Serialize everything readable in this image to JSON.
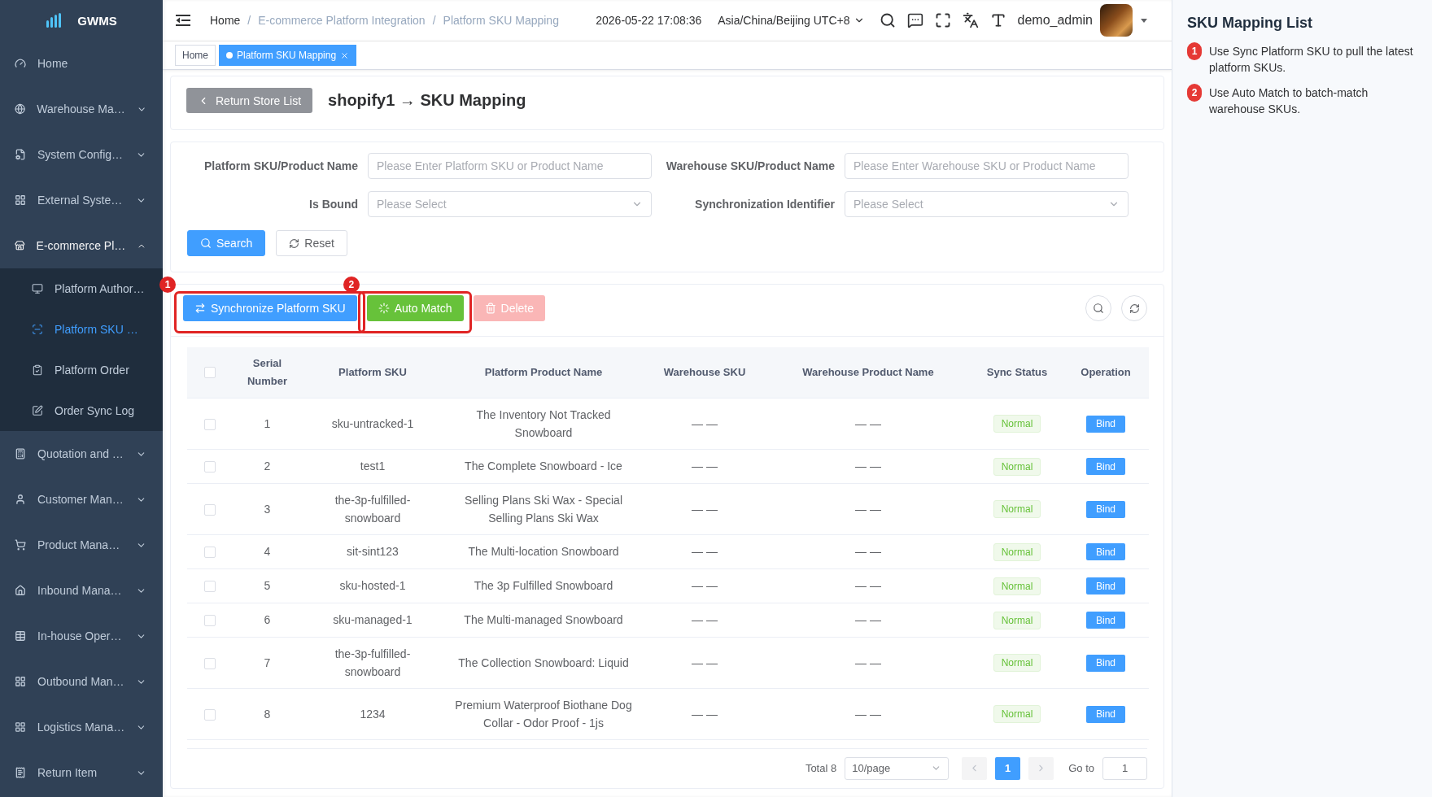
{
  "sidebar": {
    "logo": "GWMS",
    "items": [
      {
        "kind": "link",
        "label": "Home"
      },
      {
        "kind": "menu",
        "label": "Warehouse Ma…",
        "expanded": false
      },
      {
        "kind": "menu",
        "label": "System Config…",
        "expanded": false
      },
      {
        "kind": "menu",
        "label": "External Syste…",
        "expanded": false
      },
      {
        "kind": "menu",
        "label": "E-commerce Pl…",
        "expanded": true,
        "children": [
          {
            "label": "Platform Author…",
            "selected": false
          },
          {
            "label": "Platform SKU …",
            "selected": true
          },
          {
            "label": "Platform Order",
            "selected": false
          },
          {
            "label": "Order Sync Log",
            "selected": false
          }
        ]
      },
      {
        "kind": "menu",
        "label": "Quotation and …",
        "expanded": false
      },
      {
        "kind": "menu",
        "label": "Customer Man…",
        "expanded": false
      },
      {
        "kind": "menu",
        "label": "Product Mana…",
        "expanded": false
      },
      {
        "kind": "menu",
        "label": "Inbound Mana…",
        "expanded": false
      },
      {
        "kind": "menu",
        "label": "In-house Oper…",
        "expanded": false
      },
      {
        "kind": "menu",
        "label": "Outbound Man…",
        "expanded": false
      },
      {
        "kind": "menu",
        "label": "Logistics Mana…",
        "expanded": false
      },
      {
        "kind": "menu",
        "label": "Return Item",
        "expanded": false
      }
    ]
  },
  "header": {
    "breadcrumb": {
      "separator": "/",
      "items": [
        {
          "label": "Home",
          "link": true
        },
        {
          "label": "E-commerce Platform Integration",
          "link": false
        },
        {
          "label": "Platform SKU Mapping",
          "link": false
        }
      ]
    },
    "datetime": "2026-05-22 17:08:36",
    "timezone": "Asia/China/Beijing UTC+8",
    "user": "demo_admin"
  },
  "tags": [
    {
      "label": "Home",
      "selected": false
    },
    {
      "label": "Platform SKU Mapping",
      "selected": true
    }
  ],
  "page_header": {
    "back_button": "Return Store List",
    "title": "shopify1 → SKU Mapping"
  },
  "filters": {
    "fields": [
      {
        "kind": "input",
        "label": "Platform SKU/Product Name",
        "placeholder": "Please Enter Platform SKU or Product Name"
      },
      {
        "kind": "input",
        "label": "Warehouse SKU/Product Name",
        "placeholder": "Please Enter Warehouse SKU or Product Name"
      },
      {
        "kind": "select",
        "label": "Is Bound",
        "placeholder": "Please Select"
      },
      {
        "kind": "select",
        "label": "Synchronization Identifier",
        "placeholder": "Please Select"
      }
    ],
    "buttons": [
      {
        "kind": "primary",
        "label": "Search"
      },
      {
        "kind": "default",
        "label": "Reset"
      }
    ]
  },
  "toolbar": {
    "actions": [
      {
        "kind": "sync",
        "label": "Synchronize Platform SKU",
        "disabled": false,
        "annotation": "1"
      },
      {
        "kind": "match",
        "label": "Auto Match",
        "disabled": false,
        "annotation": "2"
      },
      {
        "kind": "delete",
        "label": "Delete",
        "disabled": true
      }
    ]
  },
  "table": {
    "select_all": {
      "checked": false
    },
    "columns": [
      "Serial Number",
      "Platform SKU",
      "Platform Product Name",
      "Warehouse SKU",
      "Warehouse Product Name",
      "Sync Status",
      "Operation"
    ],
    "rows": [
      {
        "checked": false,
        "serial": "1",
        "platform_sku": "sku-untracked-1",
        "product_name": "The Inventory Not Tracked Snowboard",
        "warehouse_sku": "— —",
        "warehouse_product_name": "— —",
        "sync_status": "Normal",
        "action": "Bind"
      },
      {
        "checked": false,
        "serial": "2",
        "platform_sku": "test1",
        "product_name": "The Complete Snowboard - Ice",
        "warehouse_sku": "— —",
        "warehouse_product_name": "— —",
        "sync_status": "Normal",
        "action": "Bind"
      },
      {
        "checked": false,
        "serial": "3",
        "platform_sku": "the-3p-fulfilled-snowboard",
        "product_name": "Selling Plans Ski Wax - Special Selling Plans Ski Wax",
        "warehouse_sku": "— —",
        "warehouse_product_name": "— —",
        "sync_status": "Normal",
        "action": "Bind"
      },
      {
        "checked": false,
        "serial": "4",
        "platform_sku": "sit-sint123",
        "product_name": "The Multi-location Snowboard",
        "warehouse_sku": "— —",
        "warehouse_product_name": "— —",
        "sync_status": "Normal",
        "action": "Bind"
      },
      {
        "checked": false,
        "serial": "5",
        "platform_sku": "sku-hosted-1",
        "product_name": "The 3p Fulfilled Snowboard",
        "warehouse_sku": "— —",
        "warehouse_product_name": "— —",
        "sync_status": "Normal",
        "action": "Bind"
      },
      {
        "checked": false,
        "serial": "6",
        "platform_sku": "sku-managed-1",
        "product_name": "The Multi-managed Snowboard",
        "warehouse_sku": "— —",
        "warehouse_product_name": "— —",
        "sync_status": "Normal",
        "action": "Bind"
      },
      {
        "checked": false,
        "serial": "7",
        "platform_sku": "the-3p-fulfilled-snowboard",
        "product_name": "The Collection Snowboard: Liquid",
        "warehouse_sku": "— —",
        "warehouse_product_name": "— —",
        "sync_status": "Normal",
        "action": "Bind"
      },
      {
        "checked": false,
        "serial": "8",
        "platform_sku": "1234",
        "product_name": "Premium Waterproof Biothane Dog Collar - Odor Proof - 1js",
        "warehouse_sku": "— —",
        "warehouse_product_name": "— —",
        "sync_status": "Normal",
        "action": "Bind"
      }
    ]
  },
  "pagination": {
    "total": "Total 8",
    "page_size": "10/page",
    "prev": {
      "disabled": true
    },
    "pages": [
      {
        "label": "1",
        "selected": true
      }
    ],
    "next": {
      "disabled": true
    },
    "goto_label": "Go to",
    "goto_value": "1"
  },
  "guide": {
    "title": "SKU Mapping List",
    "steps": [
      {
        "number": "1",
        "text": "Use Sync Platform SKU to pull the latest platform SKUs."
      },
      {
        "number": "2",
        "text": "Use Auto Match to batch-match warehouse SKUs."
      }
    ]
  }
}
